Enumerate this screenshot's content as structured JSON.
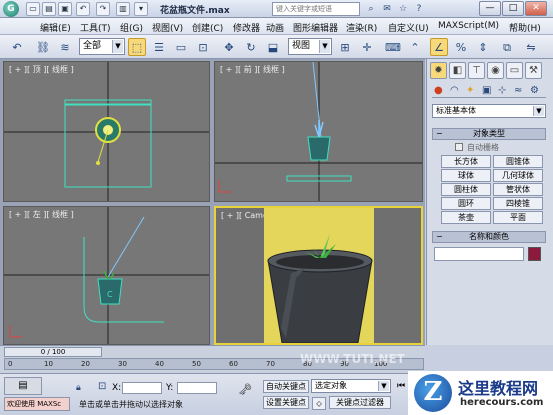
{
  "titlebar": {
    "logo": "G",
    "document_title": "花盆瓶文件.max",
    "search_placeholder": "键入关键字或短语"
  },
  "menubar": {
    "items": [
      "编辑(E)",
      "工具(T)",
      "组(G)",
      "视图(V)",
      "创建(C)",
      "修改器",
      "动画",
      "图形编辑器",
      "渲染(R)",
      "自定义(U)",
      "MAXScript(M)",
      "帮助(H)"
    ]
  },
  "toolbar": {
    "selection_filter": "全部",
    "reference_coord": "视图"
  },
  "viewports": {
    "top": "[ + ][ 顶 ][ 线框 ]",
    "front": "[ + ][ 前 ][ 线框 ]",
    "left": "[ + ][ 左 ][ 线框 ]",
    "camera": "[ + ][ Camera ][ 平滑 + 高光 ]"
  },
  "command_panel": {
    "category_dropdown": "标准基本体",
    "object_type_title": "对象类型",
    "auto_grid_label": "自动栅格",
    "buttons": [
      "长方体",
      "圆锥体",
      "球体",
      "几何球体",
      "圆柱体",
      "管状体",
      "圆环",
      "四棱锥",
      "茶壶",
      "平面"
    ],
    "name_color_title": "名称和颜色",
    "object_color": "#8b1a3c"
  },
  "timeline": {
    "frame_counter": "0 / 100",
    "ticks": [
      "0",
      "10",
      "20",
      "30",
      "40",
      "50",
      "60",
      "70",
      "80",
      "90",
      "100"
    ]
  },
  "statusbar": {
    "maxscript_label": "欢迎使用 MAXSc",
    "hint_text": "单击或单击并拖动以选择对象",
    "x_label": "X:",
    "y_label": "Y:",
    "auto_key_label": "自动关键点",
    "selected_object_dropdown": "选定对象",
    "set_key_label": "设置关键点",
    "key_filter_label": "关键点过滤器"
  },
  "watermark": {
    "site_name": "这里教程网",
    "site_url": "herecours.com",
    "url_overlay": "WWW.TUTI.NET"
  },
  "colors": {
    "viewport_bg": "#777777",
    "camera_bg": "#e3d65a",
    "active_border": "#e8d43a",
    "wireframe_cyan": "#40e0c0",
    "pot_dark": "#3a3d42",
    "plant_green": "#3cb03c"
  }
}
